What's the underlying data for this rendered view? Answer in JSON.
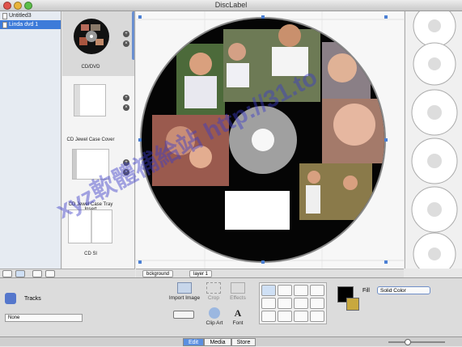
{
  "window": {
    "title": "DiscLabel"
  },
  "documents": [
    {
      "name": "Untitled3",
      "selected": false
    },
    {
      "name": "Linda dvd 1",
      "selected": true
    }
  ],
  "templates": [
    {
      "label": "CD/DVD"
    },
    {
      "label": "CD Jewel Case Cover"
    },
    {
      "label": "CD Jewel Case Tray Insert"
    },
    {
      "label": "CD Sl"
    }
  ],
  "layers": {
    "background": "bckground",
    "layer1": "layer 1"
  },
  "bottom": {
    "tracks_label": "Tracks",
    "tracks_select": "None",
    "import_image": "Import Image",
    "crop": "Crop",
    "effects": "Effects",
    "clip_art": "Clip Art",
    "font": "Font",
    "fill_label": "Fill",
    "fill_select": "Solid Color"
  },
  "modes": [
    {
      "label": "Edit",
      "active": true
    },
    {
      "label": "Media",
      "active": false
    },
    {
      "label": "Store",
      "active": false
    }
  ],
  "watermark": "xyz軟體補給站 http://31.to",
  "colors": {
    "accent": "#3d7bd9",
    "fill_color": "#000000"
  }
}
